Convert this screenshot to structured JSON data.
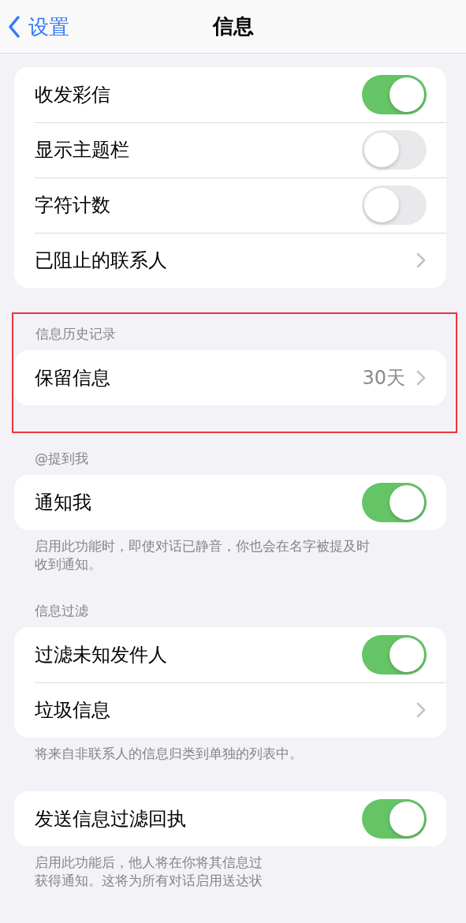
{
  "nav": {
    "back": "设置",
    "title": "信息"
  },
  "sections": [
    {
      "rows": [
        {
          "kind": "toggle",
          "label": "收发彩信",
          "on": true
        },
        {
          "kind": "toggle",
          "label": "显示主题栏",
          "on": false
        },
        {
          "kind": "toggle",
          "label": "字符计数",
          "on": false
        },
        {
          "kind": "link",
          "label": "已阻止的联系人"
        }
      ]
    },
    {
      "highlighted": true,
      "header": "信息历史记录",
      "rows": [
        {
          "kind": "link",
          "label": "保留信息",
          "value": "30天"
        }
      ]
    },
    {
      "header": "@提到我",
      "rows": [
        {
          "kind": "toggle",
          "label": "通知我",
          "on": true
        }
      ],
      "footer_lines": [
        "启用此功能时，即使对话已静音，你也会在名字被提及时",
        "收到通知。"
      ]
    },
    {
      "header": "信息过滤",
      "rows": [
        {
          "kind": "toggle",
          "label": "过滤未知发件人",
          "on": true
        },
        {
          "kind": "link",
          "label": "垃圾信息"
        }
      ],
      "footer_lines": [
        "将来自非联系人的信息归类到单独的列表中。"
      ]
    },
    {
      "rows": [
        {
          "kind": "toggle",
          "label": "发送信息过滤回执",
          "on": true
        }
      ],
      "footer_lines": [
        "启用此功能后，他人将在你将其信息过",
        "获得通知。这将为所有对话启用送达状"
      ]
    }
  ]
}
